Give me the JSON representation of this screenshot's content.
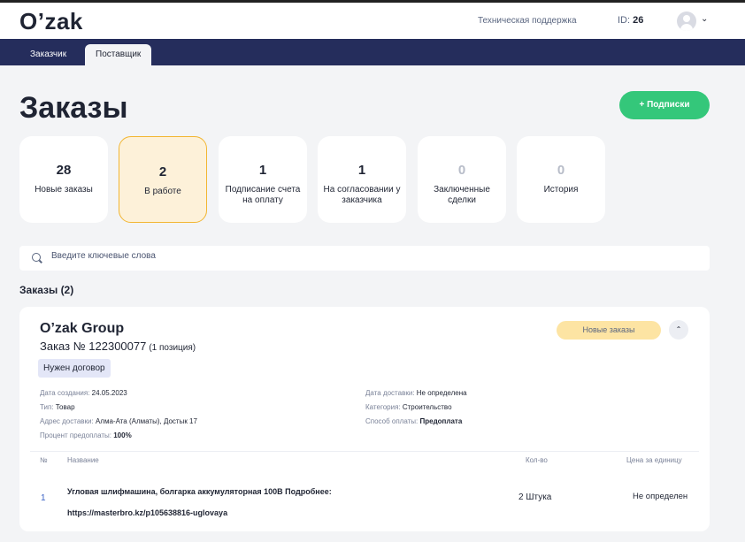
{
  "app": {
    "logo": "O’zak"
  },
  "header": {
    "support": "Техническая поддержка",
    "id_label": "ID:",
    "id_value": "26"
  },
  "nav": {
    "tabs": [
      {
        "label": "Заказчик"
      },
      {
        "label": "Поставщик"
      }
    ]
  },
  "page": {
    "title": "Заказы",
    "subscribe_button": "+ Подписки"
  },
  "status_cards": [
    {
      "count": "28",
      "label": "Новые заказы"
    },
    {
      "count": "2",
      "label": "В работе"
    },
    {
      "count": "1",
      "label": "Подписание счета на оплату"
    },
    {
      "count": "1",
      "label": "На согласовании у заказчика"
    },
    {
      "count": "0",
      "label": "Заключенные сделки"
    },
    {
      "count": "0",
      "label": "История"
    }
  ],
  "search": {
    "placeholder": "Введите ключевые слова"
  },
  "orders_section": {
    "title": "Заказы (2)"
  },
  "order": {
    "company": "O’zak Group",
    "number": "Заказ № 122300077",
    "positions": "(1 позиция)",
    "badge": "Нужен договор",
    "status": "Новые заказы",
    "meta_left": [
      {
        "label": "Дата создания:",
        "value": "24.05.2023"
      },
      {
        "label": "Тип:",
        "value": "Товар"
      },
      {
        "label": "Адрес доставки:",
        "value": "Алма-Ата (Алматы), Достык 17"
      },
      {
        "label": "Процент предоплаты:",
        "value": "100%"
      }
    ],
    "meta_right": [
      {
        "label": "Дата доставки:",
        "value": "Не определена"
      },
      {
        "label": "Категория:",
        "value": "Строительство"
      },
      {
        "label": "Способ оплаты:",
        "value": "Предоплата"
      }
    ],
    "table": {
      "headers": [
        "№",
        "Название",
        "Кол-во",
        "Цена за единицу"
      ],
      "rows": [
        {
          "n": "1",
          "name": "Угловая шлифмашина, болгарка аккумуляторная 100В Подробнее:",
          "link": "https://masterbro.kz/p105638816-uglovaya",
          "qty": "2 Штука",
          "price": "Не определен"
        }
      ]
    }
  }
}
